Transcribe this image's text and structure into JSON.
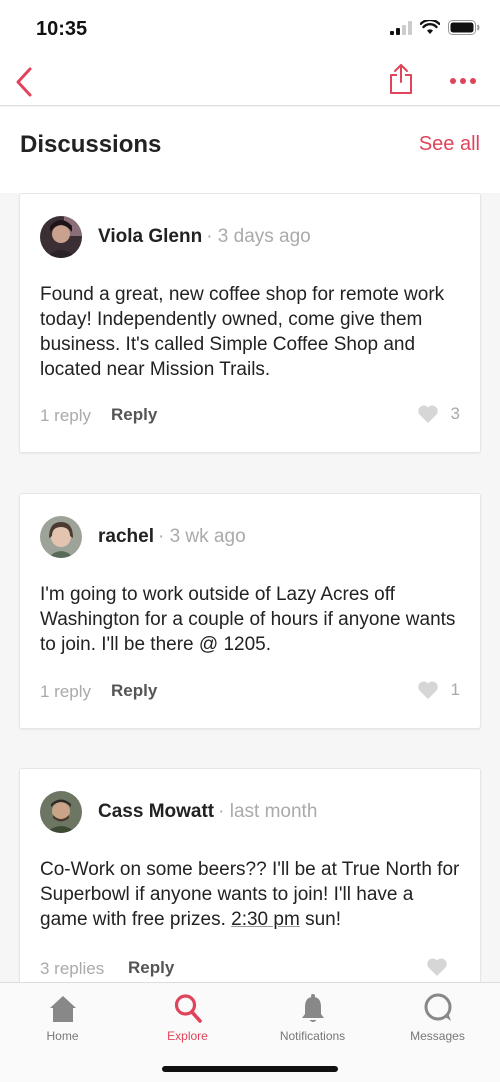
{
  "status_bar": {
    "time": "10:35"
  },
  "nav": {
    "back_icon": "chevron-left-icon",
    "share_icon": "share-icon",
    "more_icon": "more-horizontal-icon"
  },
  "section": {
    "title": "Discussions",
    "see_all": "See all"
  },
  "posts": [
    {
      "author": "Viola Glenn",
      "time": "· 3 days ago",
      "body": "Found a great, new coffee shop for remote work today! Independently owned, come give them business. It's called Simple Coffee Shop and located near Mission Trails.",
      "replies": "1 reply",
      "reply_label": "Reply",
      "likes": "3"
    },
    {
      "author": "rachel",
      "time": "· 3 wk ago",
      "body": "I'm going to work outside of Lazy Acres off Washington for a couple of hours if anyone wants to join.  I'll be there @ 1205.",
      "replies": "1 reply",
      "reply_label": "Reply",
      "likes": "1"
    },
    {
      "author": "Cass Mowatt",
      "time": "· last month",
      "body_pre": "Co-Work on some beers?? I'll be at True North for Superbowl if anyone wants to join! I'll have a game with free prizes. ",
      "body_link": "2:30 pm",
      "body_post": " sun!",
      "replies": "3 replies",
      "reply_label": "Reply",
      "likes": ""
    }
  ],
  "tabs": [
    {
      "label": "Home",
      "icon": "home-icon",
      "active": false
    },
    {
      "label": "Explore",
      "icon": "search-icon",
      "active": true
    },
    {
      "label": "Notifications",
      "icon": "bell-icon",
      "active": false
    },
    {
      "label": "Messages",
      "icon": "chat-bubble-icon",
      "active": false
    }
  ],
  "colors": {
    "accent": "#e0445a",
    "muted": "#aaaaaa",
    "background": "#f6f6f6"
  }
}
